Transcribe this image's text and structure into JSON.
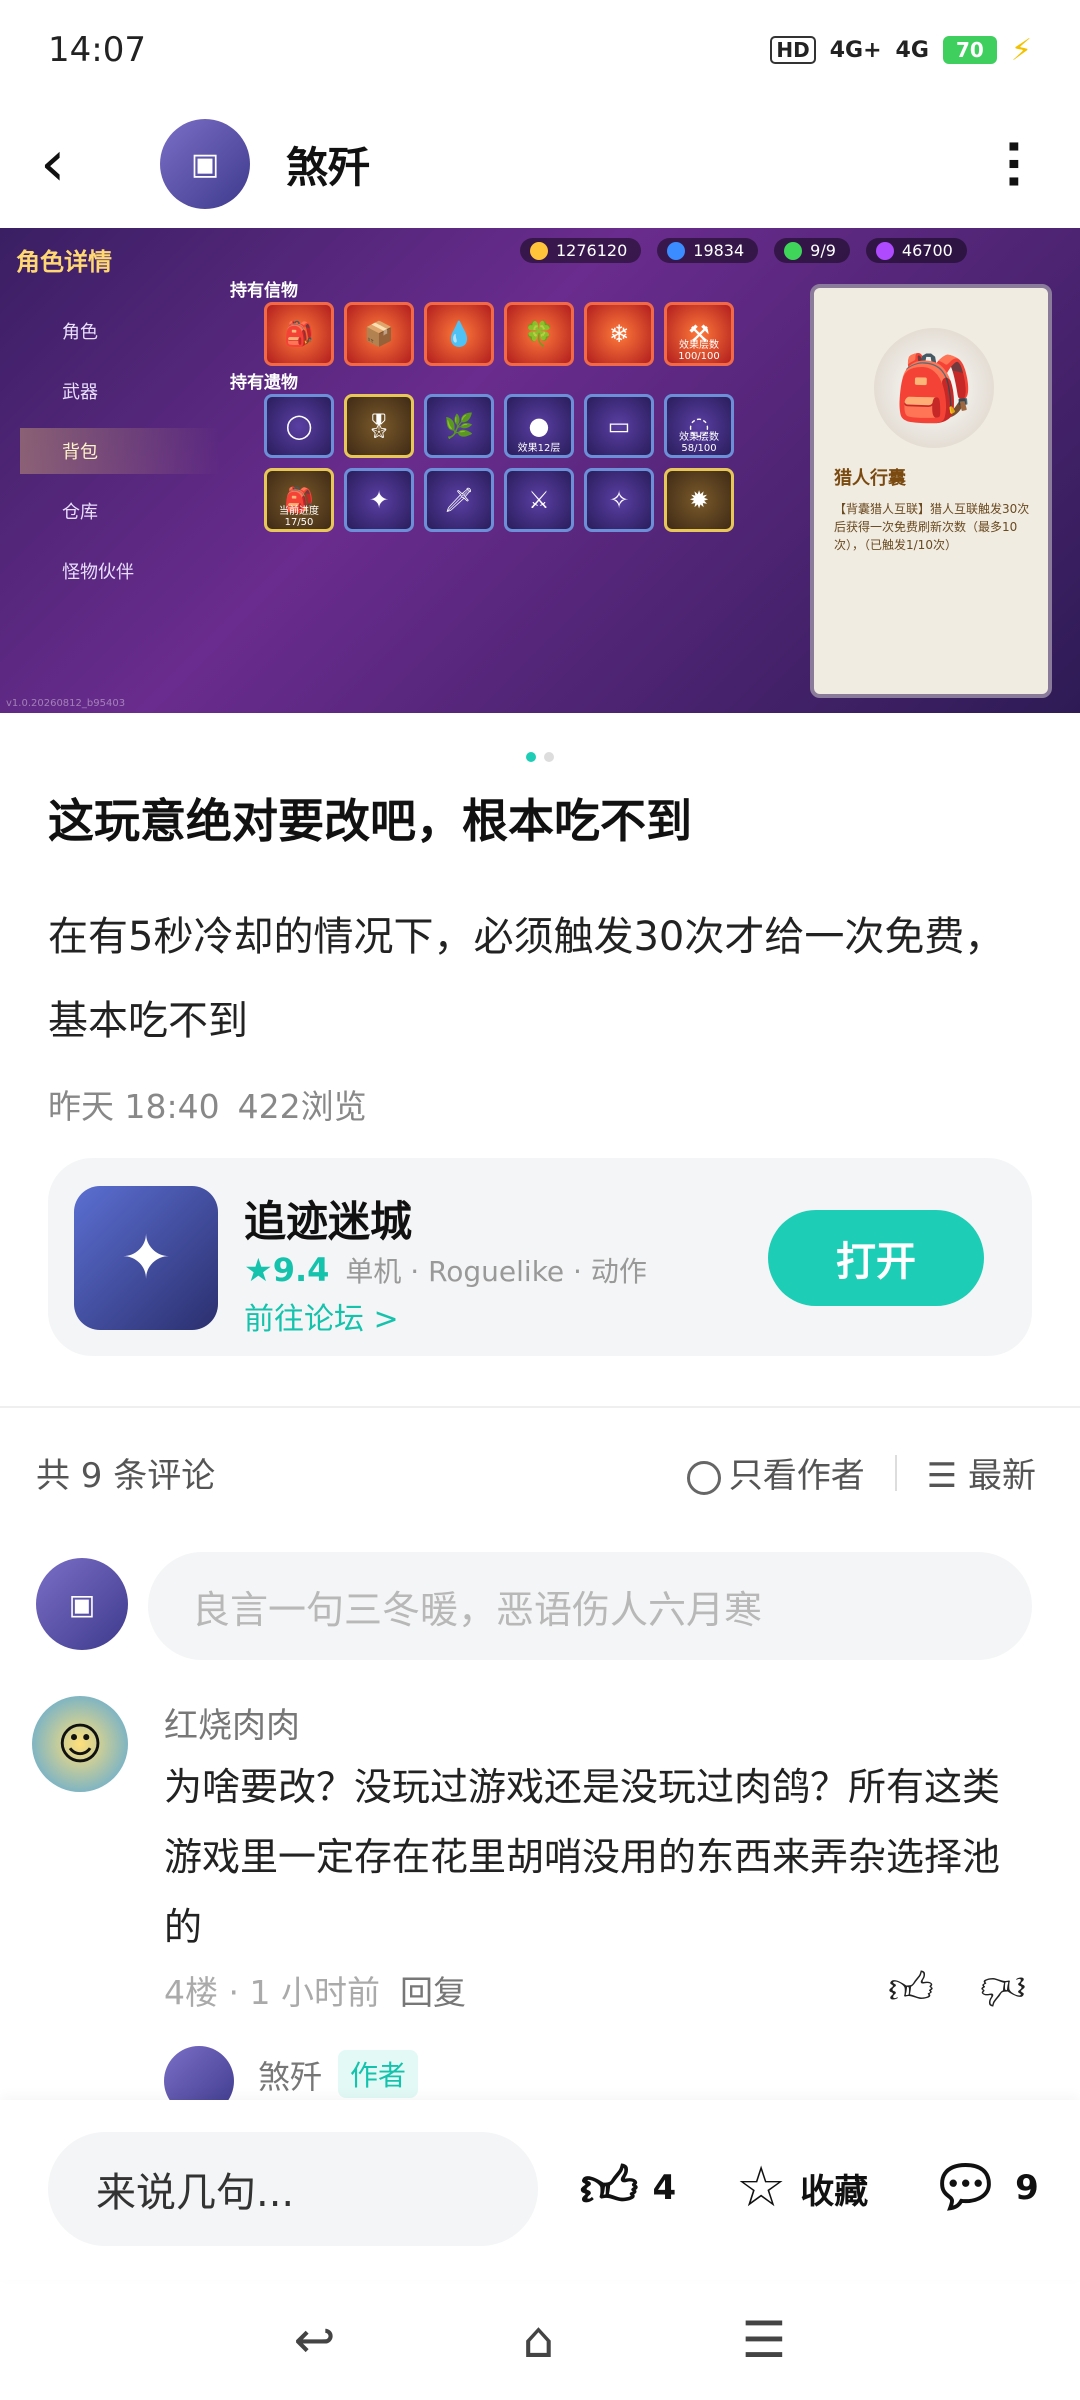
{
  "status": {
    "time": "14:07",
    "net1": "HD",
    "net2": "4G+",
    "net3": "4G",
    "battery": "70"
  },
  "header": {
    "name": "煞歼"
  },
  "banner": {
    "title": "角色详情",
    "stats": [
      "1276120",
      "19834",
      "9/9",
      "46700"
    ],
    "menu": [
      "角色",
      "武器",
      "背包",
      "仓库",
      "怪物伙伴"
    ],
    "section1": "持有信物",
    "section2": "持有遗物",
    "slot_caps": [
      "效果层数 100/100",
      "效果12层",
      "效果层数 58/100",
      "当前进度 17/50"
    ],
    "detail_name": "猎人行囊",
    "detail_desc": "【背囊猎人互联】猎人互联触发30次后获得一次免费刷新次数（最多10次），（已触发1/10次）",
    "version": "v1.0.20260812_b95403"
  },
  "post": {
    "title": "这玩意绝对要改吧，根本吃不到",
    "body": "在有5秒冷却的情况下，必须触发30次才给一次免费，基本吃不到",
    "date": "昨天 18:40",
    "views": "422浏览"
  },
  "game": {
    "name": "追迹迷城",
    "rating": "9.4",
    "tags": "单机 · Roguelike · 动作",
    "forum": "前往论坛 >",
    "open": "打开"
  },
  "comments": {
    "count": "共 9 条评论",
    "author_only": "只看作者",
    "sort": "最新",
    "input_placeholder": "良言一句三冬暖，恶语伤人六月寒",
    "items": [
      {
        "user": "红烧肉肉",
        "text": "为啥要改？没玩过游戏还是没玩过肉鸽？所有这类游戏里一定存在花里胡哨没用的东西来弄杂选择池的",
        "floor": "4楼 · 1 小时前",
        "reply": "回复"
      }
    ],
    "sub_user": "煞歼",
    "sub_badge": "作者"
  },
  "actions": {
    "say": "来说几句...",
    "likes": "4",
    "favorite": "收藏",
    "comments": "9"
  }
}
